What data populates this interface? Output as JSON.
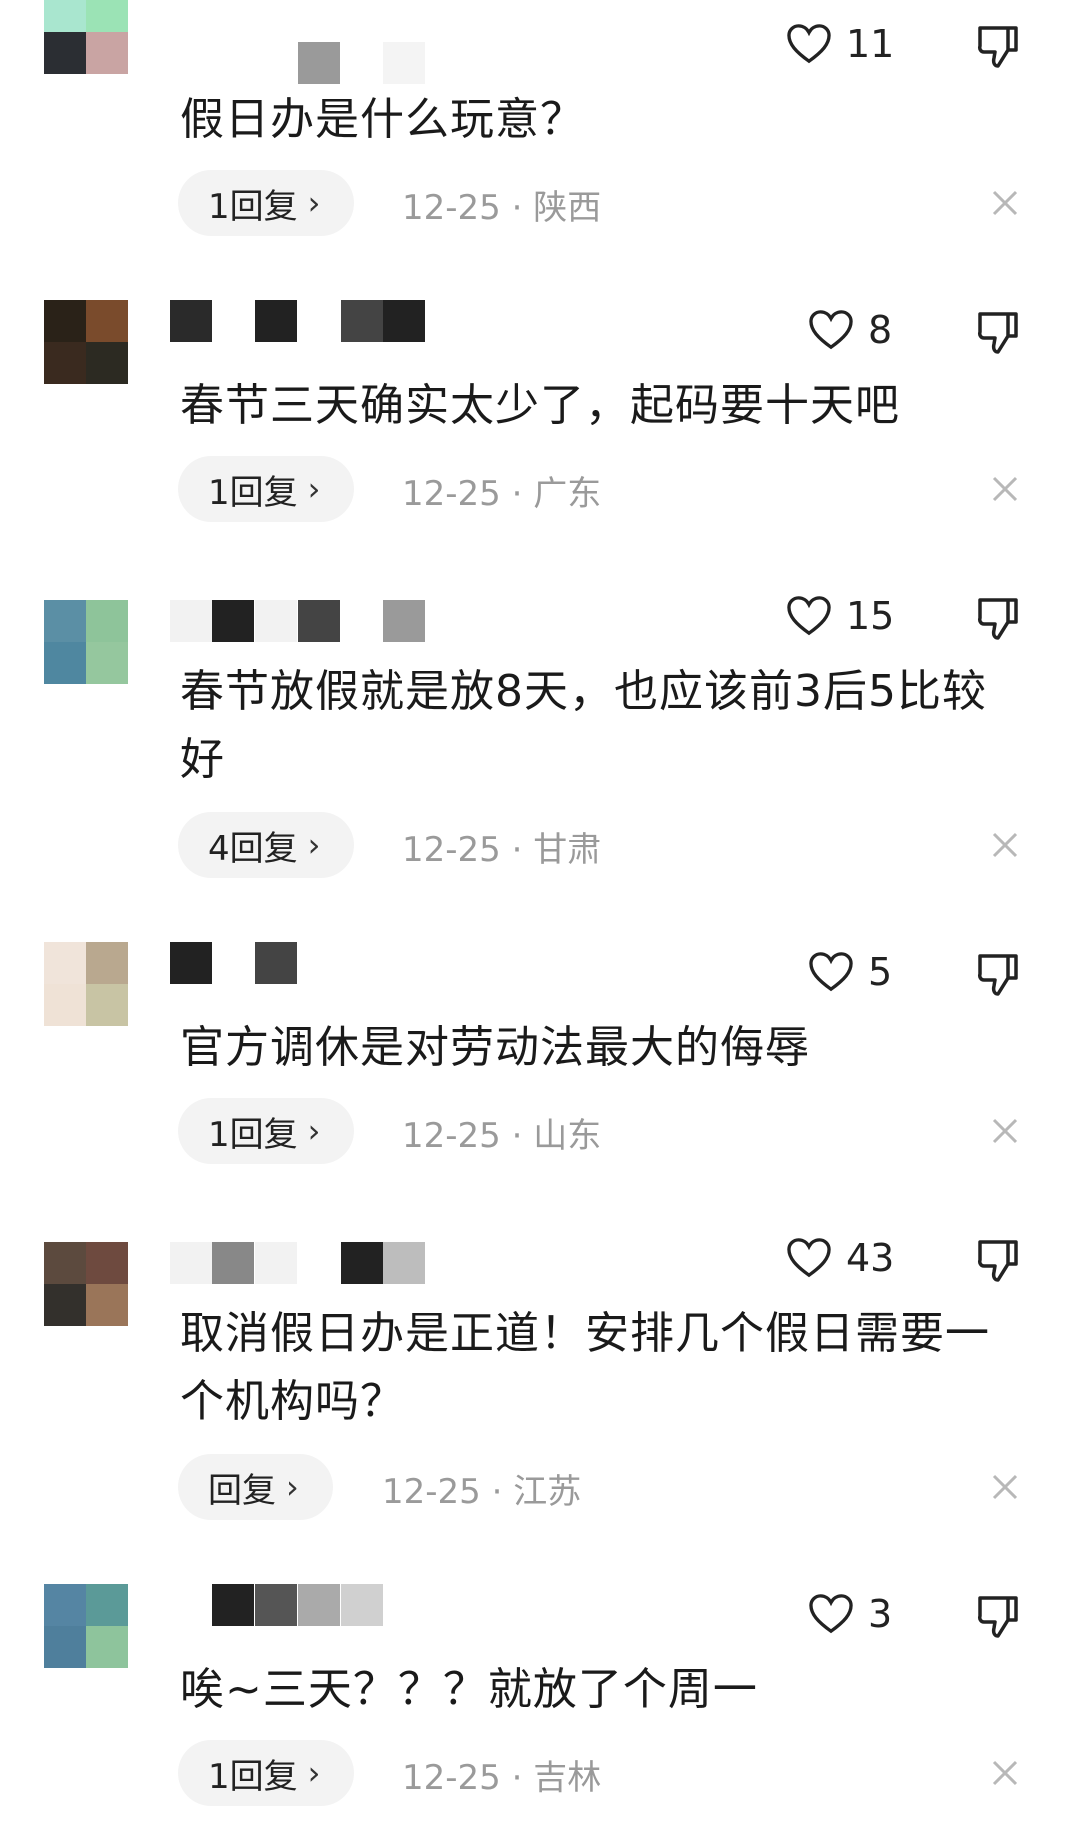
{
  "colors": {
    "pill_bg": "#f3f3f3",
    "meta_text": "#9a9a9a",
    "text": "#1a1a1a"
  },
  "comments": [
    {
      "text": "假日办是什么玩意？",
      "likes": "11",
      "reply": "1回复",
      "date": "12-25",
      "region": "陕西"
    },
    {
      "text": "春节三天确实太少了，起码要十天吧",
      "likes": "8",
      "reply": "1回复",
      "date": "12-25",
      "region": "广东"
    },
    {
      "text": "春节放假就是放8天，也应该前3后5比较好",
      "likes": "15",
      "reply": "4回复",
      "date": "12-25",
      "region": "甘肃"
    },
    {
      "text": "官方调休是对劳动法最大的侮辱",
      "likes": "5",
      "reply": "1回复",
      "date": "12-25",
      "region": "山东"
    },
    {
      "text": "取消假日办是正道！安排几个假日需要一个机构吗？",
      "likes": "43",
      "reply": "回复",
      "date": "12-25",
      "region": "江苏"
    },
    {
      "text": "唉~三天？？？就放了个周一",
      "likes": "3",
      "reply": "1回复",
      "date": "12-25",
      "region": "吉林"
    }
  ],
  "icons": {
    "like": "heart-outline-icon",
    "dislike": "thumbs-down-icon",
    "reply": "chevron-right-icon",
    "close": "close-icon"
  }
}
